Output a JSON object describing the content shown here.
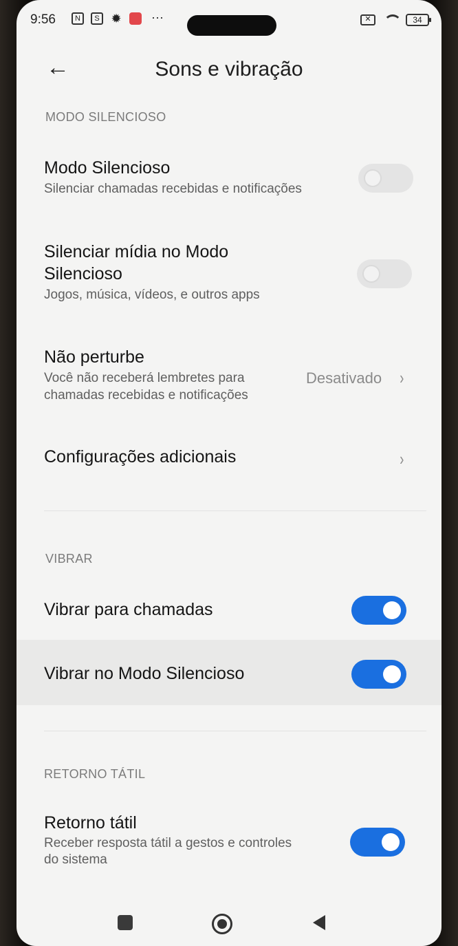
{
  "status_bar": {
    "time": "9:56",
    "icons": [
      "nfc-icon",
      "sim-icon",
      "gear-icon",
      "mail-icon",
      "more-dots-icon"
    ],
    "battery": "34"
  },
  "header": {
    "title": "Sons e vibração"
  },
  "sections": {
    "silent_mode": "MODO SILENCIOSO",
    "vibrate": "VIBRAR",
    "haptic": "RETORNO TÁTIL"
  },
  "settings": {
    "silent_mode": {
      "title": "Modo Silencioso",
      "desc": "Silenciar chamadas recebidas e notificações",
      "enabled": false
    },
    "mute_media": {
      "title_line1": "Silenciar mídia no Modo",
      "title_line2": "Silencioso",
      "desc": "Jogos, música, vídeos, e outros apps",
      "enabled": false
    },
    "do_not_disturb": {
      "title": "Não perturbe",
      "desc_line1": "Você não receberá lembretes para",
      "desc_line2": "chamadas recebidas e notificações",
      "value": "Desativado"
    },
    "additional": {
      "title": "Configurações adicionais"
    },
    "vibrate_calls": {
      "title": "Vibrar para chamadas",
      "enabled": true
    },
    "vibrate_silent": {
      "title": "Vibrar no Modo Silencioso",
      "enabled": true
    },
    "haptic": {
      "title": "Retorno tátil",
      "desc_line1": "Receber resposta tátil a gestos e controles",
      "desc_line2": "do sistema",
      "enabled": true
    }
  },
  "colors": {
    "toggle_on": "#1a6fe0",
    "toggle_off": "#e4e4e4",
    "background": "#f4f4f3"
  }
}
